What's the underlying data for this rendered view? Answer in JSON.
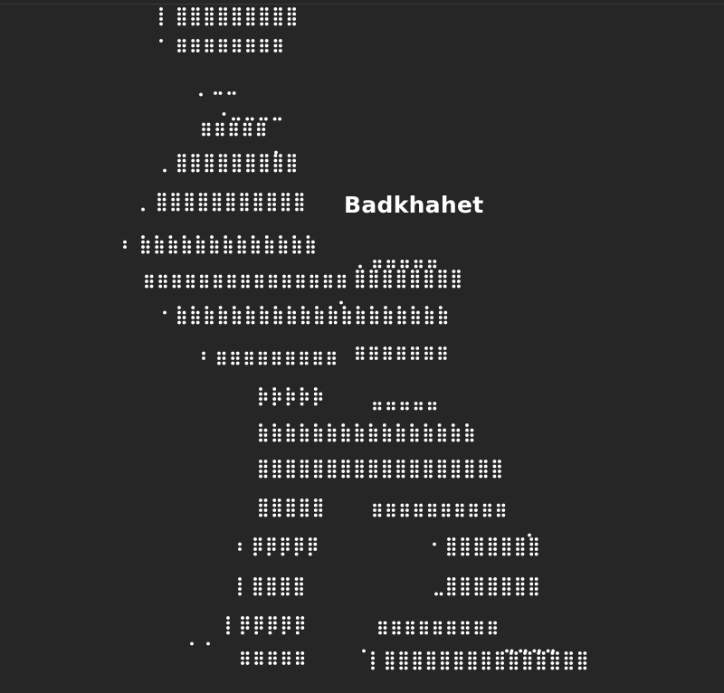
{
  "caption": "Badkhahet",
  "colors": {
    "background": "#262626",
    "dots": "#ffffff"
  }
}
